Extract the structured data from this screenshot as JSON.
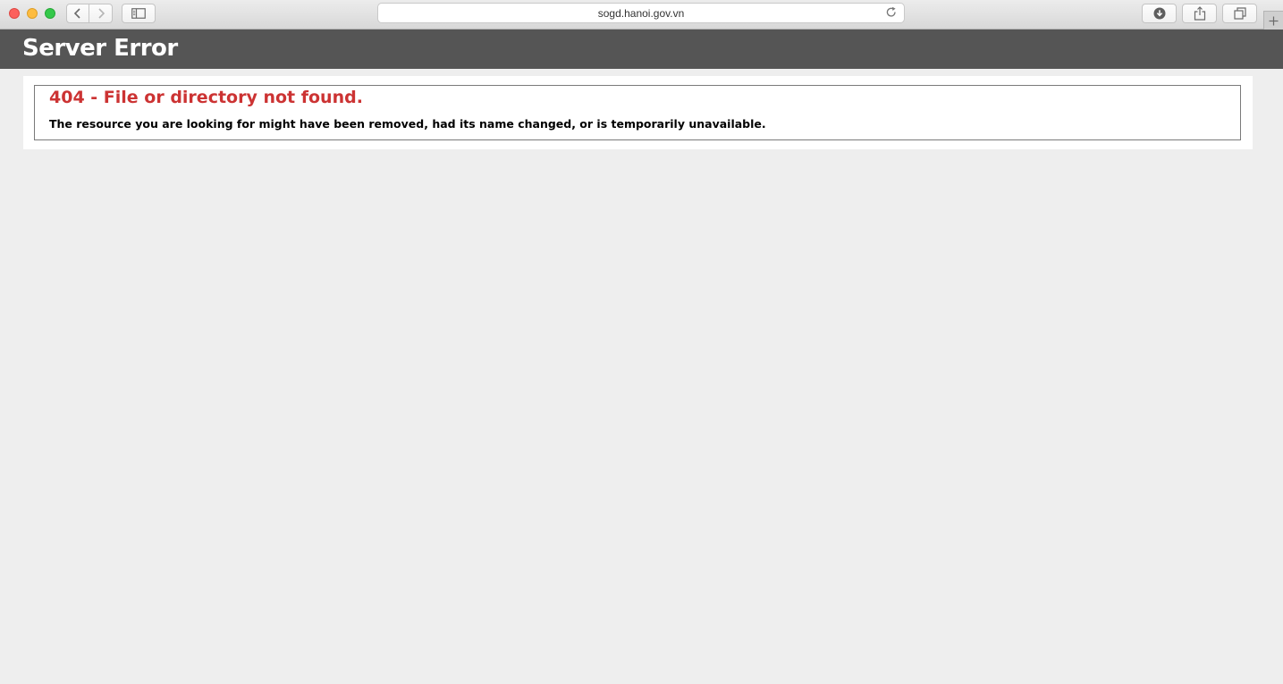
{
  "browser": {
    "url": "sogd.hanoi.gov.vn",
    "icons": {
      "back": "chevron-left-icon",
      "forward": "chevron-right-icon",
      "sidebar": "sidebar-icon",
      "reload": "reload-icon",
      "downloads": "download-icon",
      "share": "share-icon",
      "tabs": "tabs-overview-icon",
      "new_tab": "plus-icon"
    }
  },
  "page": {
    "header_title": "Server Error",
    "error_title": "404 - File or directory not found.",
    "error_description": "The resource you are looking for might have been removed, had its name changed, or is temporarily unavailable."
  },
  "colors": {
    "header_bg": "#555555",
    "error_title": "#cc3333",
    "page_bg": "#eeeeee"
  }
}
